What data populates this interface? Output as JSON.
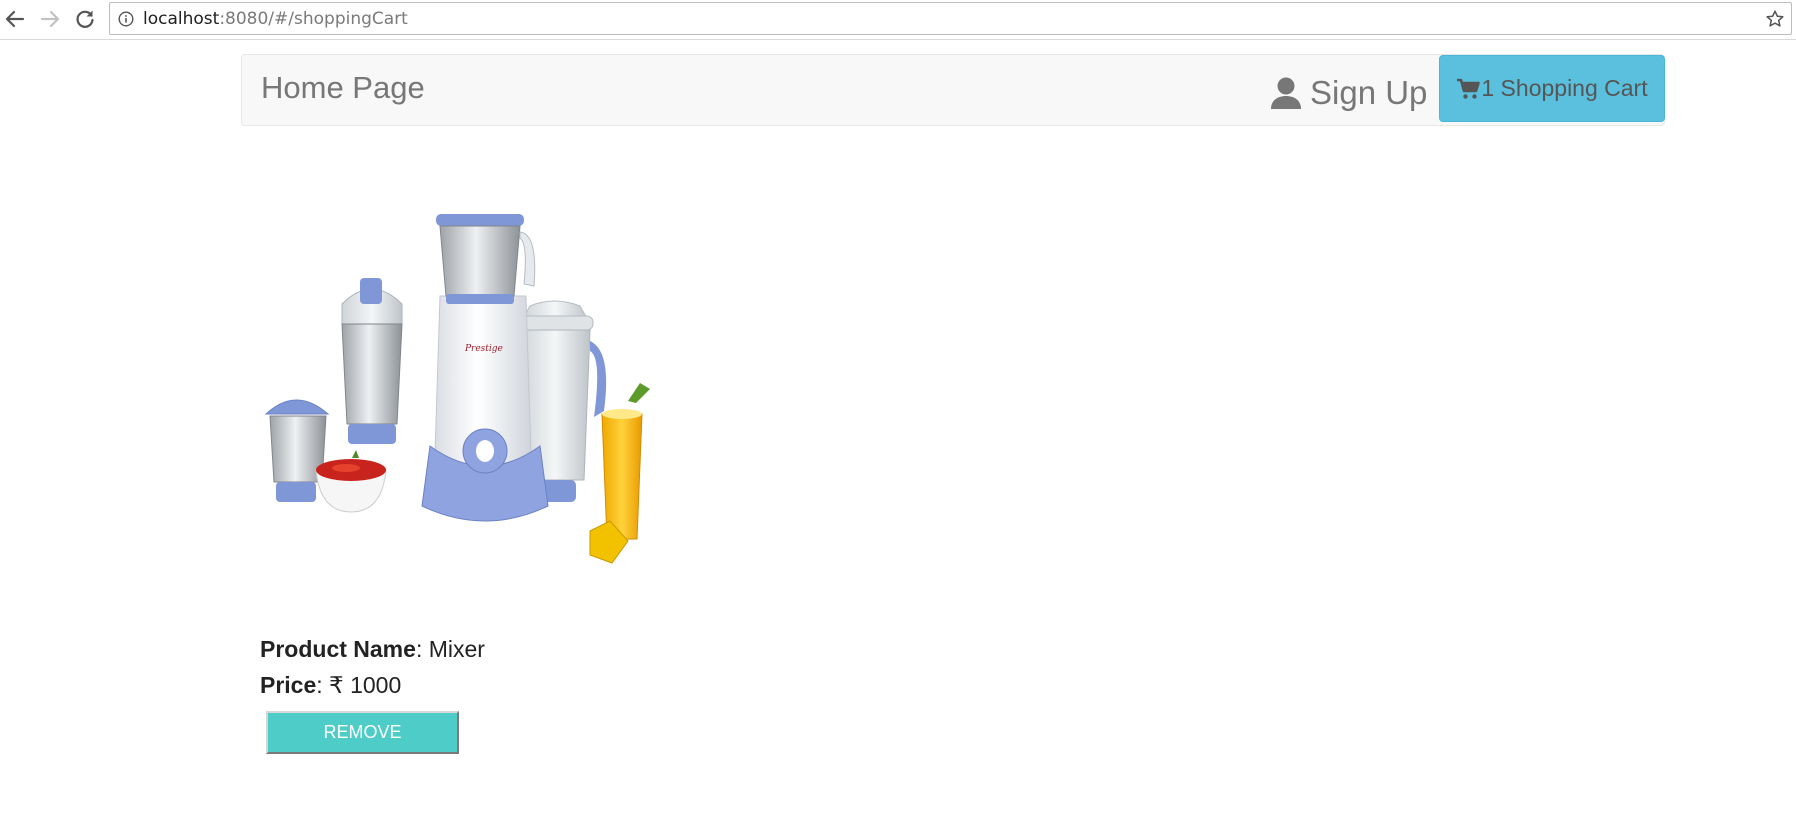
{
  "browser": {
    "url_host": "localhost",
    "url_path": ":8080/#/shoppingCart",
    "icons": [
      "back-arrow-icon",
      "forward-arrow-icon",
      "reload-icon",
      "info-icon",
      "bookmark-star-icon"
    ]
  },
  "navbar": {
    "brand": "Home Page",
    "signup_label": "Sign Up",
    "cart_count": "1",
    "cart_label": " Shopping Cart",
    "colors": {
      "navbar_bg": "#f8f8f8",
      "cart_button_bg": "#5bc0de"
    }
  },
  "product": {
    "name_label": "Product Name",
    "name_value": ": Mixer",
    "price_label": "Price",
    "price_value": ": ₹ 1000",
    "remove_label": "REMOVE",
    "image": "mixer-grinder-image",
    "colors": {
      "remove_button_bg": "#4ecdc8"
    }
  }
}
